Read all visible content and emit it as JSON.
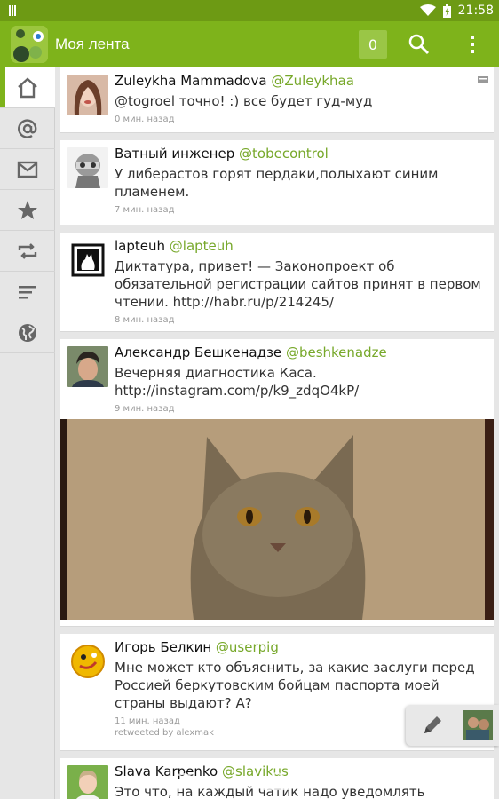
{
  "status_bar": {
    "time": "21:58"
  },
  "action_bar": {
    "title": "Моя лента",
    "counter": "0"
  },
  "sidebar": {
    "items": [
      {
        "icon": "home-icon",
        "active": true
      },
      {
        "icon": "mention-icon"
      },
      {
        "icon": "mail-icon"
      },
      {
        "icon": "star-icon"
      },
      {
        "icon": "retweet-icon"
      },
      {
        "icon": "list-icon"
      },
      {
        "icon": "globe-icon"
      }
    ]
  },
  "tweets": [
    {
      "name": "Zuleykha Mammadova",
      "handle": "@Zuleykhaa",
      "text": "@togroel точно! :) все будет гуд-муд",
      "time": "0 мин. назад"
    },
    {
      "name": "Ватный инженер",
      "handle": "@tobecontrol",
      "text": "У либерастов горят пердаки,полыхают синим пламенем.",
      "time": "7 мин. назад"
    },
    {
      "name": "lapteuh",
      "handle": "@lapteuh",
      "text": "Диктатура, привет! — Законопроект об обязательной регистрации сайтов принят в первом чтении. http://habr.ru/p/214245/",
      "time": "8 мин. назад"
    },
    {
      "name": "Александр Бешкенадзе",
      "handle": "@beshkenadze",
      "text": "Вечерняя диагностика Каса. http://instagram.com/p/k9_zdqO4kP/",
      "time": "9 мин. назад"
    },
    {
      "name": "Игорь Белкин",
      "handle": "@userpig",
      "text": "Мне может кто объяснить, за какие заслуги перед Россией  беркутовским бойцам паспорта моей страны выдают? А?",
      "time": "11 мин. назад",
      "retweeted": "retweeted by alexmak"
    },
    {
      "name": "Slava Karpenko",
      "handle": "@slavikus",
      "text": "Это что, на каждый чатик надо уведомлять Роскомнадзор?"
    }
  ],
  "colors": {
    "accent": "#7eb31b",
    "handle": "#77a82a",
    "statusbar": "#6d9a14"
  }
}
